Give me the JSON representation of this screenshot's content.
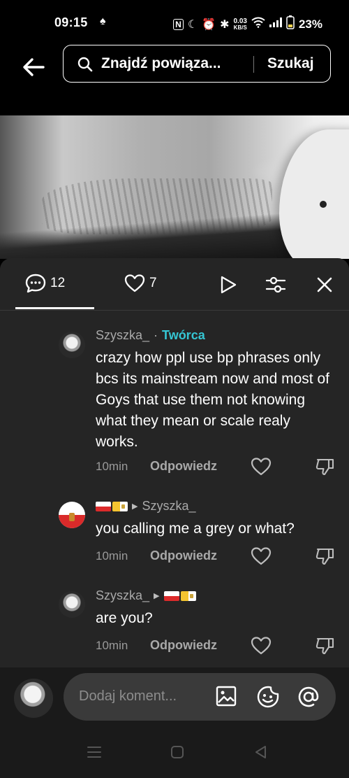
{
  "status_bar": {
    "time": "09:15",
    "speed_value": "0.03",
    "speed_unit": "KB/S",
    "battery": "23%"
  },
  "top_bar": {
    "search_query": "Znajdź powiąza...",
    "search_button": "Szukaj"
  },
  "comment_sheet": {
    "tabs": {
      "comments_count": "12",
      "likes_count": "7"
    },
    "comments": [
      {
        "username": "Szyszka_",
        "separator": "·",
        "badge": "Twórca",
        "text": "crazy how ppl use bp phrases only bcs its mainstream now and most of Goys that use them not knowing what they mean or scale realy works.",
        "time": "10min",
        "reply_label": "Odpowiedz"
      },
      {
        "reply_to": "Szyszka_",
        "text": "you calling me a grey or what?",
        "time": "10min",
        "reply_label": "Odpowiedz"
      },
      {
        "username": "Szyszka_",
        "text": "are you?",
        "time": "10min",
        "reply_label": "Odpowiedz"
      }
    ]
  },
  "composer": {
    "placeholder": "Dodaj koment..."
  },
  "icons": [
    "back-arrow-icon",
    "search-icon",
    "comment-icon",
    "heart-icon",
    "play-icon",
    "filter-icon",
    "close-icon",
    "like-icon",
    "dislike-icon",
    "image-icon",
    "emoji-icon",
    "mention-icon",
    "nav-menu-icon",
    "nav-home-icon",
    "nav-back-icon"
  ],
  "colors": {
    "sheet_bg": "#252525",
    "creator_badge": "#35c6d4",
    "screen_bg": "#000000"
  }
}
